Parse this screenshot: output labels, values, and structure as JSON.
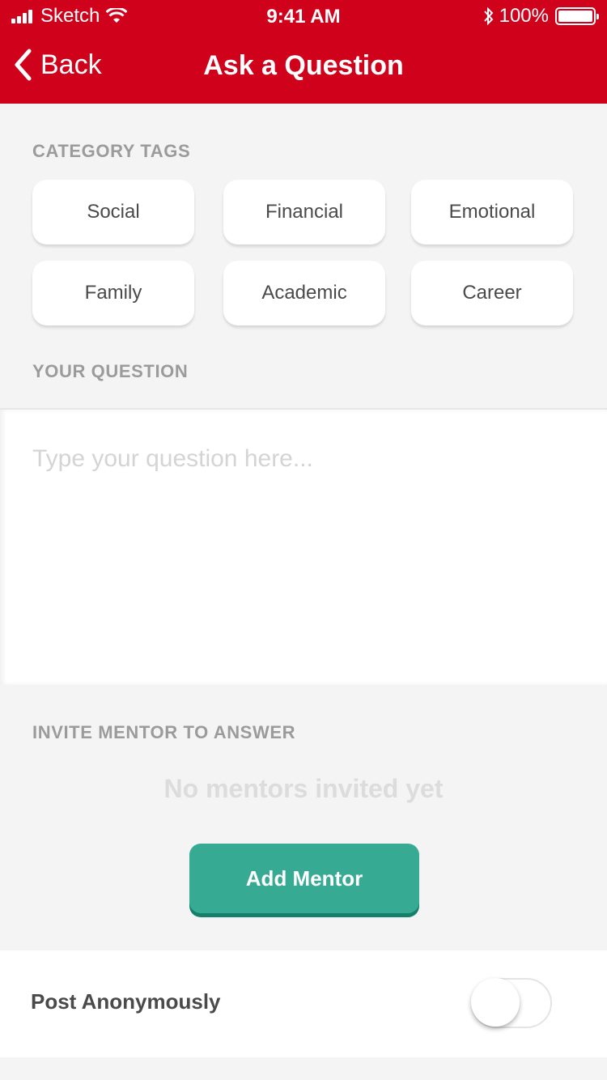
{
  "status_bar": {
    "carrier": "Sketch",
    "time": "9:41 AM",
    "battery": "100%"
  },
  "nav": {
    "back_label": "Back",
    "title": "Ask a Question"
  },
  "category": {
    "label": "CATEGORY TAGS",
    "tags": [
      "Social",
      "Financial",
      "Emotional",
      "Family",
      "Academic",
      "Career"
    ]
  },
  "question": {
    "label": "YOUR QUESTION",
    "placeholder": "Type your question here...",
    "value": ""
  },
  "mentor": {
    "label": "INVITE MENTOR TO ANSWER",
    "empty_text": "No mentors invited yet",
    "add_button": "Add Mentor"
  },
  "anonymous": {
    "label": "Post Anonymously",
    "enabled": false
  },
  "colors": {
    "brand_red": "#d0021b",
    "accent_green": "#36aa93"
  },
  "icons": [
    "signal-icon",
    "wifi-icon",
    "bluetooth-icon",
    "battery-icon",
    "chevron-left-icon"
  ]
}
